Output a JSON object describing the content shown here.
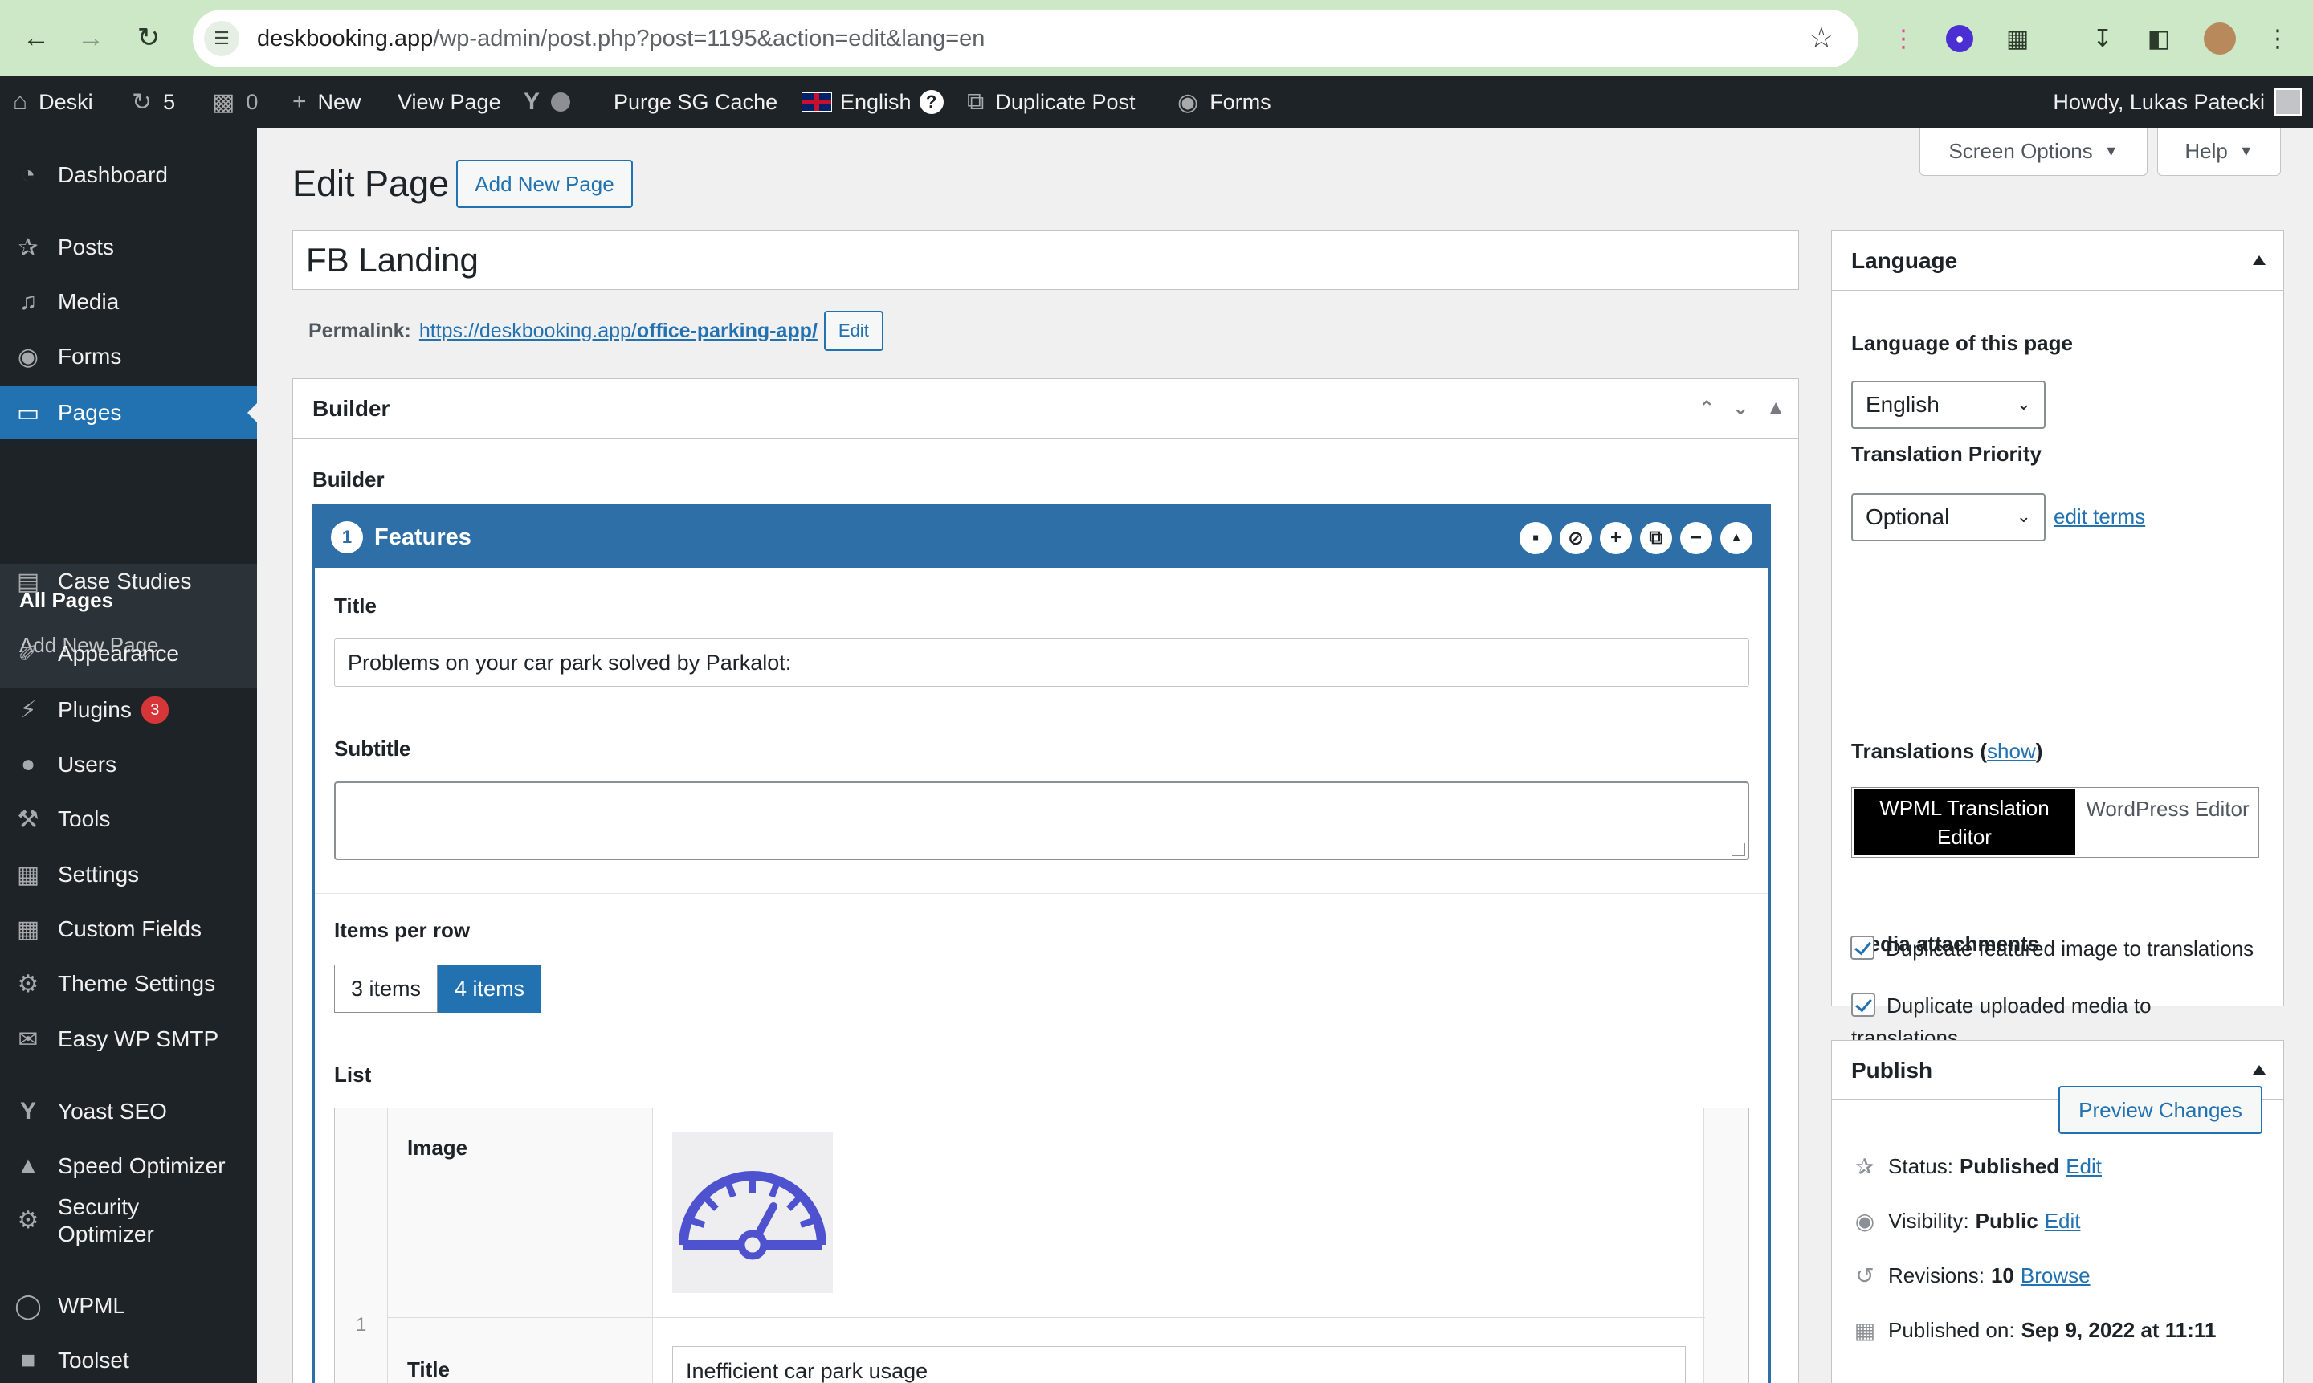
{
  "browser": {
    "url_host": "deskbooking.app",
    "url_path": "/wp-admin/post.php?post=1195&action=edit&lang=en"
  },
  "adminbar": {
    "site_name": "Deski",
    "updates_count": "5",
    "comments_count": "0",
    "new_label": "New",
    "view_page": "View Page",
    "purge_cache": "Purge SG Cache",
    "language": "English",
    "duplicate_post": "Duplicate Post",
    "forms": "Forms",
    "howdy": "Howdy, Lukas Patecki"
  },
  "sidebar": {
    "items": [
      {
        "label": "Dashboard",
        "icon": "dashboard-icon"
      },
      {
        "label": "Posts",
        "icon": "pin-icon"
      },
      {
        "label": "Media",
        "icon": "media-icon"
      },
      {
        "label": "Forms",
        "icon": "forms-icon"
      },
      {
        "label": "Pages",
        "icon": "pages-icon"
      },
      {
        "label": "Case Studies",
        "icon": "case-studies-icon"
      },
      {
        "label": "Appearance",
        "icon": "brush-icon"
      },
      {
        "label": "Plugins",
        "icon": "plugin-icon",
        "badge": "3"
      },
      {
        "label": "Users",
        "icon": "users-icon"
      },
      {
        "label": "Tools",
        "icon": "wrench-icon"
      },
      {
        "label": "Settings",
        "icon": "settings-icon"
      },
      {
        "label": "Custom Fields",
        "icon": "custom-fields-icon"
      },
      {
        "label": "Theme Settings",
        "icon": "gear-icon"
      },
      {
        "label": "Easy WP SMTP",
        "icon": "mail-icon"
      },
      {
        "label": "Yoast SEO",
        "icon": "yoast-icon"
      },
      {
        "label": "Speed Optimizer",
        "icon": "speed-icon"
      },
      {
        "label": "Security Optimizer",
        "icon": "security-icon"
      },
      {
        "label": "WPML",
        "icon": "wpml-icon"
      },
      {
        "label": "Toolset",
        "icon": "toolset-icon"
      }
    ],
    "submenu": [
      "All Pages",
      "Add New Page"
    ]
  },
  "screen_options": {
    "screen_options": "Screen Options",
    "help": "Help"
  },
  "editor": {
    "page_title": "Edit Page",
    "add_new": "Add New Page",
    "post_title": "FB Landing",
    "permalink_label": "Permalink:",
    "permalink_base": "https://deskbooking.app/",
    "permalink_slug": "office-parking-app/",
    "permalink_edit": "Edit"
  },
  "builder": {
    "box_title": "Builder",
    "inner_label": "Builder",
    "layout_number": "1",
    "layout_name": "Features",
    "fields": {
      "title_label": "Title",
      "title_value": "Problems on your car park solved by Parkalot:",
      "subtitle_label": "Subtitle",
      "items_label": "Items per row",
      "items_options": [
        "3 items",
        "4 items"
      ],
      "items_selected": "4 items",
      "list_label": "List"
    },
    "list_row": {
      "index": "1",
      "image_label": "Image",
      "title_label": "Title",
      "title_value": "Inefficient car park usage"
    }
  },
  "language_box": {
    "title": "Language",
    "lang_of_page": "Language of this page",
    "lang_selected": "English",
    "priority_label": "Translation Priority",
    "priority_selected": "Optional",
    "edit_terms": "edit terms",
    "translations_label": "Translations (",
    "show": "show",
    "translations_close": ")",
    "tab_wpml_line1": "WPML Translation",
    "tab_wpml_line2": "Editor",
    "tab_wp": "WordPress Editor",
    "media_label": "Media attachments",
    "cb_media": "Duplicate uploaded media to translations",
    "cb_featured": "Duplicate featured image to translations"
  },
  "publish_box": {
    "title": "Publish",
    "preview": "Preview Changes",
    "status_label": "Status:",
    "status_value": "Published",
    "visibility_label": "Visibility:",
    "visibility_value": "Public",
    "revisions_label": "Revisions:",
    "revisions_value": "10",
    "browse": "Browse",
    "published_label": "Published on:",
    "published_value": "Sep 9, 2022 at 11:11",
    "edit": "Edit"
  },
  "colors": {
    "accent": "#2271b1",
    "admin_dark": "#1d2327",
    "builder_blue": "#2e6fa7",
    "badge_red": "#d63638",
    "speedometer": "#4f52cf"
  }
}
